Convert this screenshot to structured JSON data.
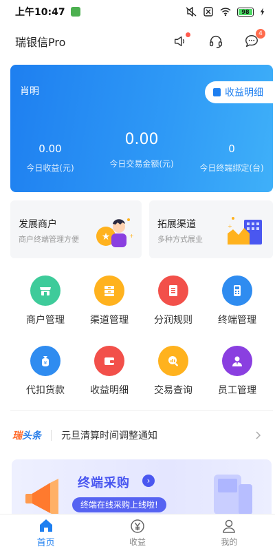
{
  "status_bar": {
    "time": "上午10:47",
    "battery": "98"
  },
  "header": {
    "title": "瑞银信Pro",
    "message_badge": "4"
  },
  "summary": {
    "merchant_name": "肖明",
    "income_detail_label": "收益明细",
    "stats": [
      {
        "value": "0.00",
        "label": "今日收益(元)"
      },
      {
        "value": "0.00",
        "label": "今日交易金额(元)"
      },
      {
        "value": "0",
        "label": "今日终端绑定(台)"
      }
    ]
  },
  "features": [
    {
      "title": "发展商户",
      "subtitle": "商户终端管理方便"
    },
    {
      "title": "拓展渠道",
      "subtitle": "多种方式展业"
    }
  ],
  "grid": [
    {
      "label": "商户管理",
      "icon": "store-icon",
      "color": "#3ecb9a"
    },
    {
      "label": "渠道管理",
      "icon": "channel-icon",
      "color": "#ffb21e"
    },
    {
      "label": "分润规则",
      "icon": "document-icon",
      "color": "#f2504a"
    },
    {
      "label": "终端管理",
      "icon": "pos-terminal-icon",
      "color": "#2f8cf0"
    },
    {
      "label": "代扣货款",
      "icon": "money-bag-icon",
      "color": "#2f8cf0"
    },
    {
      "label": "收益明细",
      "icon": "wallet-icon",
      "color": "#f2504a"
    },
    {
      "label": "交易查询",
      "icon": "search-chart-icon",
      "color": "#ffb21e"
    },
    {
      "label": "员工管理",
      "icon": "staff-icon",
      "color": "#8a3fe0"
    }
  ],
  "ticker": {
    "brand_part1": "瑞",
    "brand_part2": "头条",
    "text": "元旦清算时间调整通知"
  },
  "banner": {
    "title": "终端采购",
    "subtitle": "终端在线采购上线啦!"
  },
  "nav": [
    {
      "label": "首页",
      "icon": "home-icon",
      "active": true
    },
    {
      "label": "收益",
      "icon": "yen-icon",
      "active": false
    },
    {
      "label": "我的",
      "icon": "user-icon",
      "active": false
    }
  ],
  "colors": {
    "primary": "#1e7ff0",
    "badge": "#ff6b4d",
    "ticker_orange": "#ff6a2a",
    "banner_accent": "#4a57f0"
  }
}
